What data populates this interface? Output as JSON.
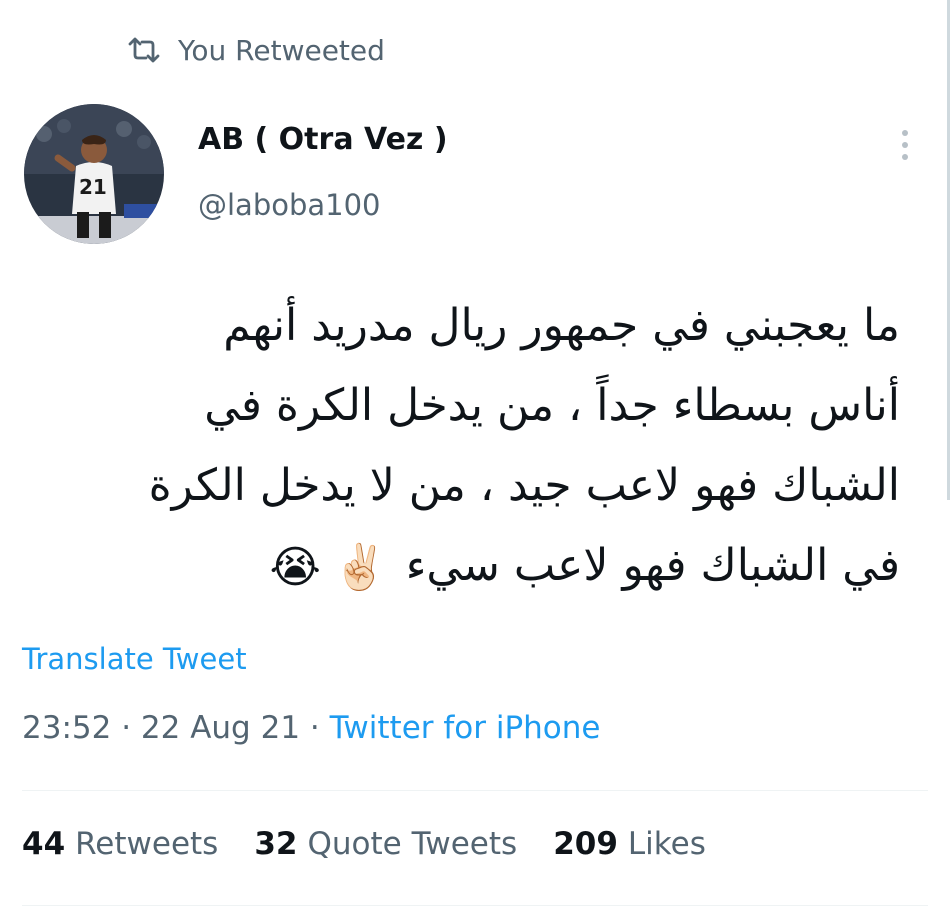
{
  "retweet": {
    "label": "You Retweeted",
    "icon": "retweet-icon"
  },
  "author": {
    "display_name": "AB ( Otra Vez )",
    "handle": "@laboba100",
    "avatar_jersey_number": "21"
  },
  "tweet": {
    "lines": [
      "ما يعجبني في جمهور ريال مدريد أنهم",
      "أناس بسطاء جداً ، من يدخل الكرة في",
      "الشباك فهو لاعب جيد ، من لا يدخل الكرة",
      "في الشباك فهو لاعب سيء"
    ],
    "emojis": [
      "✌🏻",
      "😭"
    ]
  },
  "translate_label": "Translate Tweet",
  "meta": {
    "time": "23:52",
    "separator1": " · ",
    "date": "22 Aug 21",
    "separator2": " · ",
    "source": "Twitter for iPhone"
  },
  "stats": {
    "retweets": {
      "count": "44",
      "label": "Retweets"
    },
    "quotes": {
      "count": "32",
      "label": "Quote Tweets"
    },
    "likes": {
      "count": "209",
      "label": "Likes"
    }
  },
  "colors": {
    "link": "#1d9bf0",
    "secondary_text": "#536471",
    "primary_text": "#0f1419",
    "divider": "#eff3f4"
  }
}
